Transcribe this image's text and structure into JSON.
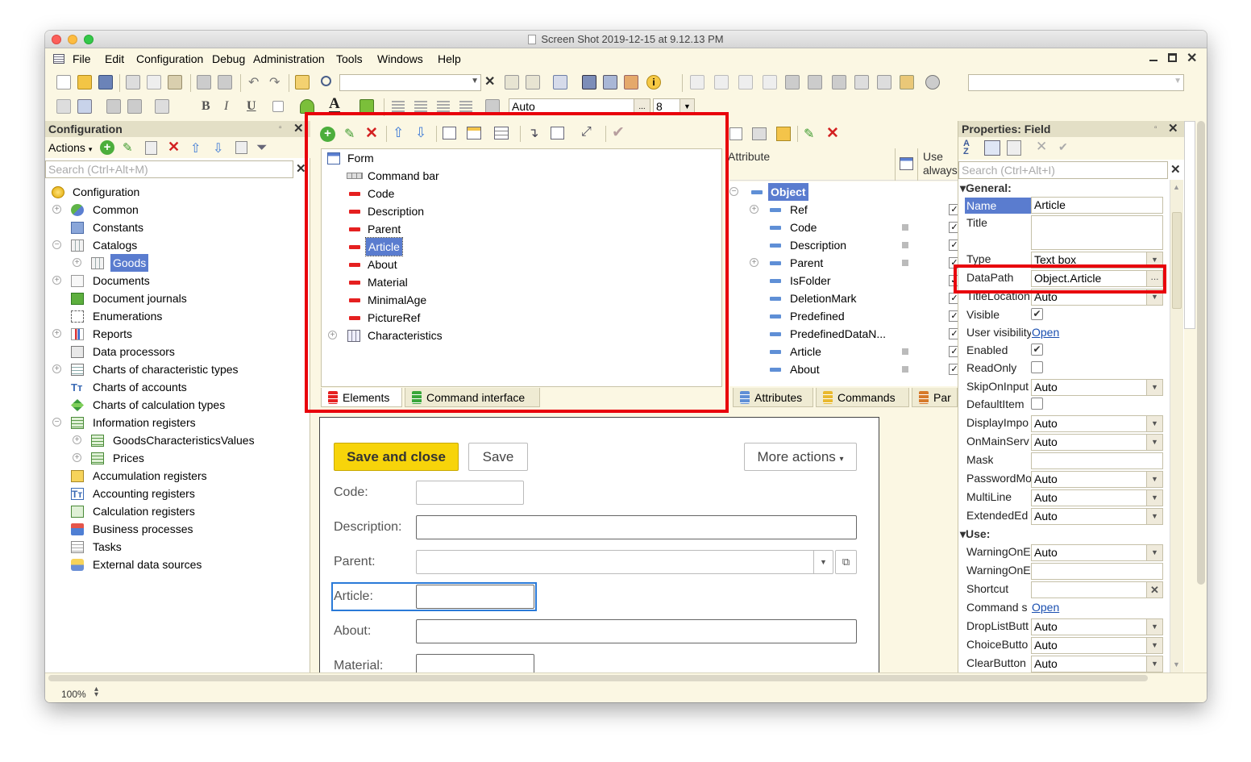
{
  "window": {
    "title": "Screen Shot 2019-12-15 at 9.12.13 PM"
  },
  "menu": [
    "File",
    "Edit",
    "Configuration",
    "Debug",
    "Administration",
    "Tools",
    "Windows",
    "Help"
  ],
  "toolbar": {
    "font_name": "Auto",
    "font_size": "8"
  },
  "config_panel": {
    "title": "Configuration",
    "actions_label": "Actions",
    "search_placeholder": "Search (Ctrl+Alt+M)",
    "items": [
      {
        "label": "Configuration"
      },
      {
        "label": "Common"
      },
      {
        "label": "Constants"
      },
      {
        "label": "Catalogs"
      },
      {
        "label": "Goods"
      },
      {
        "label": "Documents"
      },
      {
        "label": "Document journals"
      },
      {
        "label": "Enumerations"
      },
      {
        "label": "Reports"
      },
      {
        "label": "Data processors"
      },
      {
        "label": "Charts of characteristic types"
      },
      {
        "label": "Charts of accounts"
      },
      {
        "label": "Charts of calculation types"
      },
      {
        "label": "Information registers"
      },
      {
        "label": "GoodsCharacteristicsValues"
      },
      {
        "label": "Prices"
      },
      {
        "label": "Accumulation registers"
      },
      {
        "label": "Accounting registers"
      },
      {
        "label": "Calculation registers"
      },
      {
        "label": "Business processes"
      },
      {
        "label": "Tasks"
      },
      {
        "label": "External data sources"
      }
    ]
  },
  "form_tree": {
    "items": [
      {
        "label": "Form"
      },
      {
        "label": "Command bar"
      },
      {
        "label": "Code"
      },
      {
        "label": "Description"
      },
      {
        "label": "Parent"
      },
      {
        "label": "Article"
      },
      {
        "label": "About"
      },
      {
        "label": "Material"
      },
      {
        "label": "MinimalAge"
      },
      {
        "label": "PictureRef"
      },
      {
        "label": "Characteristics"
      }
    ],
    "tabs": [
      "Elements",
      "Command interface"
    ]
  },
  "attributes": {
    "col_attribute": "Attribute",
    "col_use": "Use",
    "col_always": "always",
    "items": [
      {
        "label": "Object"
      },
      {
        "label": "Ref"
      },
      {
        "label": "Code"
      },
      {
        "label": "Description"
      },
      {
        "label": "Parent"
      },
      {
        "label": "IsFolder"
      },
      {
        "label": "DeletionMark"
      },
      {
        "label": "Predefined"
      },
      {
        "label": "PredefinedDataN..."
      },
      {
        "label": "Article"
      },
      {
        "label": "About"
      }
    ],
    "tabs": [
      "Attributes",
      "Commands",
      "Par"
    ]
  },
  "properties": {
    "title": "Properties: Field",
    "search_placeholder": "Search (Ctrl+Alt+I)",
    "section_general": "General:",
    "section_use": "Use:",
    "rows": [
      {
        "label": "Name",
        "value": "Article"
      },
      {
        "label": "Title",
        "value": ""
      },
      {
        "label": "Type",
        "value": "Text box"
      },
      {
        "label": "DataPath",
        "value": "Object.Article"
      },
      {
        "label": "TitleLocation",
        "value": "Auto"
      },
      {
        "label": "Visible",
        "value": "✔"
      },
      {
        "label": "User visibility",
        "value": "Open"
      },
      {
        "label": "Enabled",
        "value": "✔"
      },
      {
        "label": "ReadOnly",
        "value": ""
      },
      {
        "label": "SkipOnInput",
        "value": "Auto"
      },
      {
        "label": "DefaultItem",
        "value": ""
      },
      {
        "label": "DisplayImpo",
        "value": "Auto"
      },
      {
        "label": "OnMainServ",
        "value": "Auto"
      },
      {
        "label": "Mask",
        "value": ""
      },
      {
        "label": "PasswordMo",
        "value": "Auto"
      },
      {
        "label": "MultiLine",
        "value": "Auto"
      },
      {
        "label": "ExtendedEd",
        "value": "Auto"
      },
      {
        "label": "WarningOnE",
        "value": "Auto"
      },
      {
        "label": "WarningOnE",
        "value": ""
      },
      {
        "label": "Shortcut",
        "value": ""
      },
      {
        "label": "Command s",
        "value": "Open"
      },
      {
        "label": "DropListButt",
        "value": "Auto"
      },
      {
        "label": "ChoiceButto",
        "value": "Auto"
      },
      {
        "label": "ClearButton",
        "value": "Auto"
      }
    ]
  },
  "preview": {
    "save_close": "Save and close",
    "save": "Save",
    "more_actions": "More actions",
    "fields": [
      "Code:",
      "Description:",
      "Parent:",
      "Article:",
      "About:",
      "Material:"
    ]
  },
  "status": {
    "zoom": "100%"
  }
}
